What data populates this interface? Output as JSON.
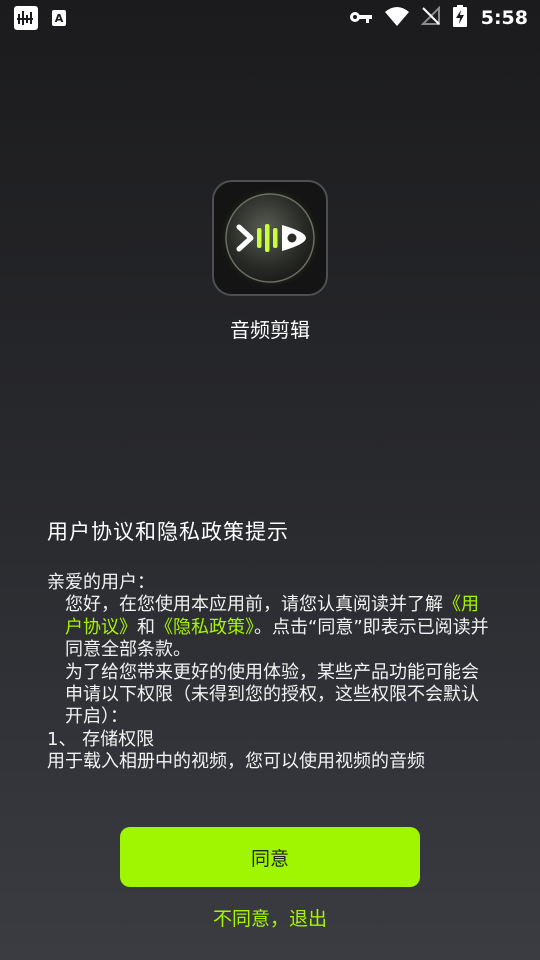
{
  "status_bar": {
    "time": "5:58",
    "left_icons": [
      "app-notification-icon",
      "a-keyboard-icon"
    ],
    "right_icons": [
      "key-icon",
      "wifi-icon",
      "no-signal-icon",
      "battery-charging-icon"
    ],
    "a_icon_label": "A"
  },
  "app": {
    "name": "音频剪辑",
    "icon": "play-waveform-icon"
  },
  "agreement": {
    "title": "用户协议和隐私政策提示",
    "greeting": "亲爱的用户：",
    "para1_before": "您好，在您使用本应用前，请您认真阅读并了解",
    "user_agreement_link": "《用户协议》",
    "and": "和",
    "privacy_policy_link": "《隐私政策》",
    "para1_after": "。点击“同意”即表示已阅读并同意全部条款。",
    "para2": "为了给您带来更好的使用体验，某些产品功能可能会申请以下权限（未得到您的授权，这些权限不会默认开启）：",
    "item1": "1、 存储权限",
    "item1_desc": "用于载入相册中的视频，您可以使用视频的音频"
  },
  "buttons": {
    "agree": "同意",
    "disagree": "不同意，退出"
  },
  "colors": {
    "accent": "#a0f600",
    "background_top": "#1b1b1d",
    "background_bottom": "#3a3c42"
  }
}
